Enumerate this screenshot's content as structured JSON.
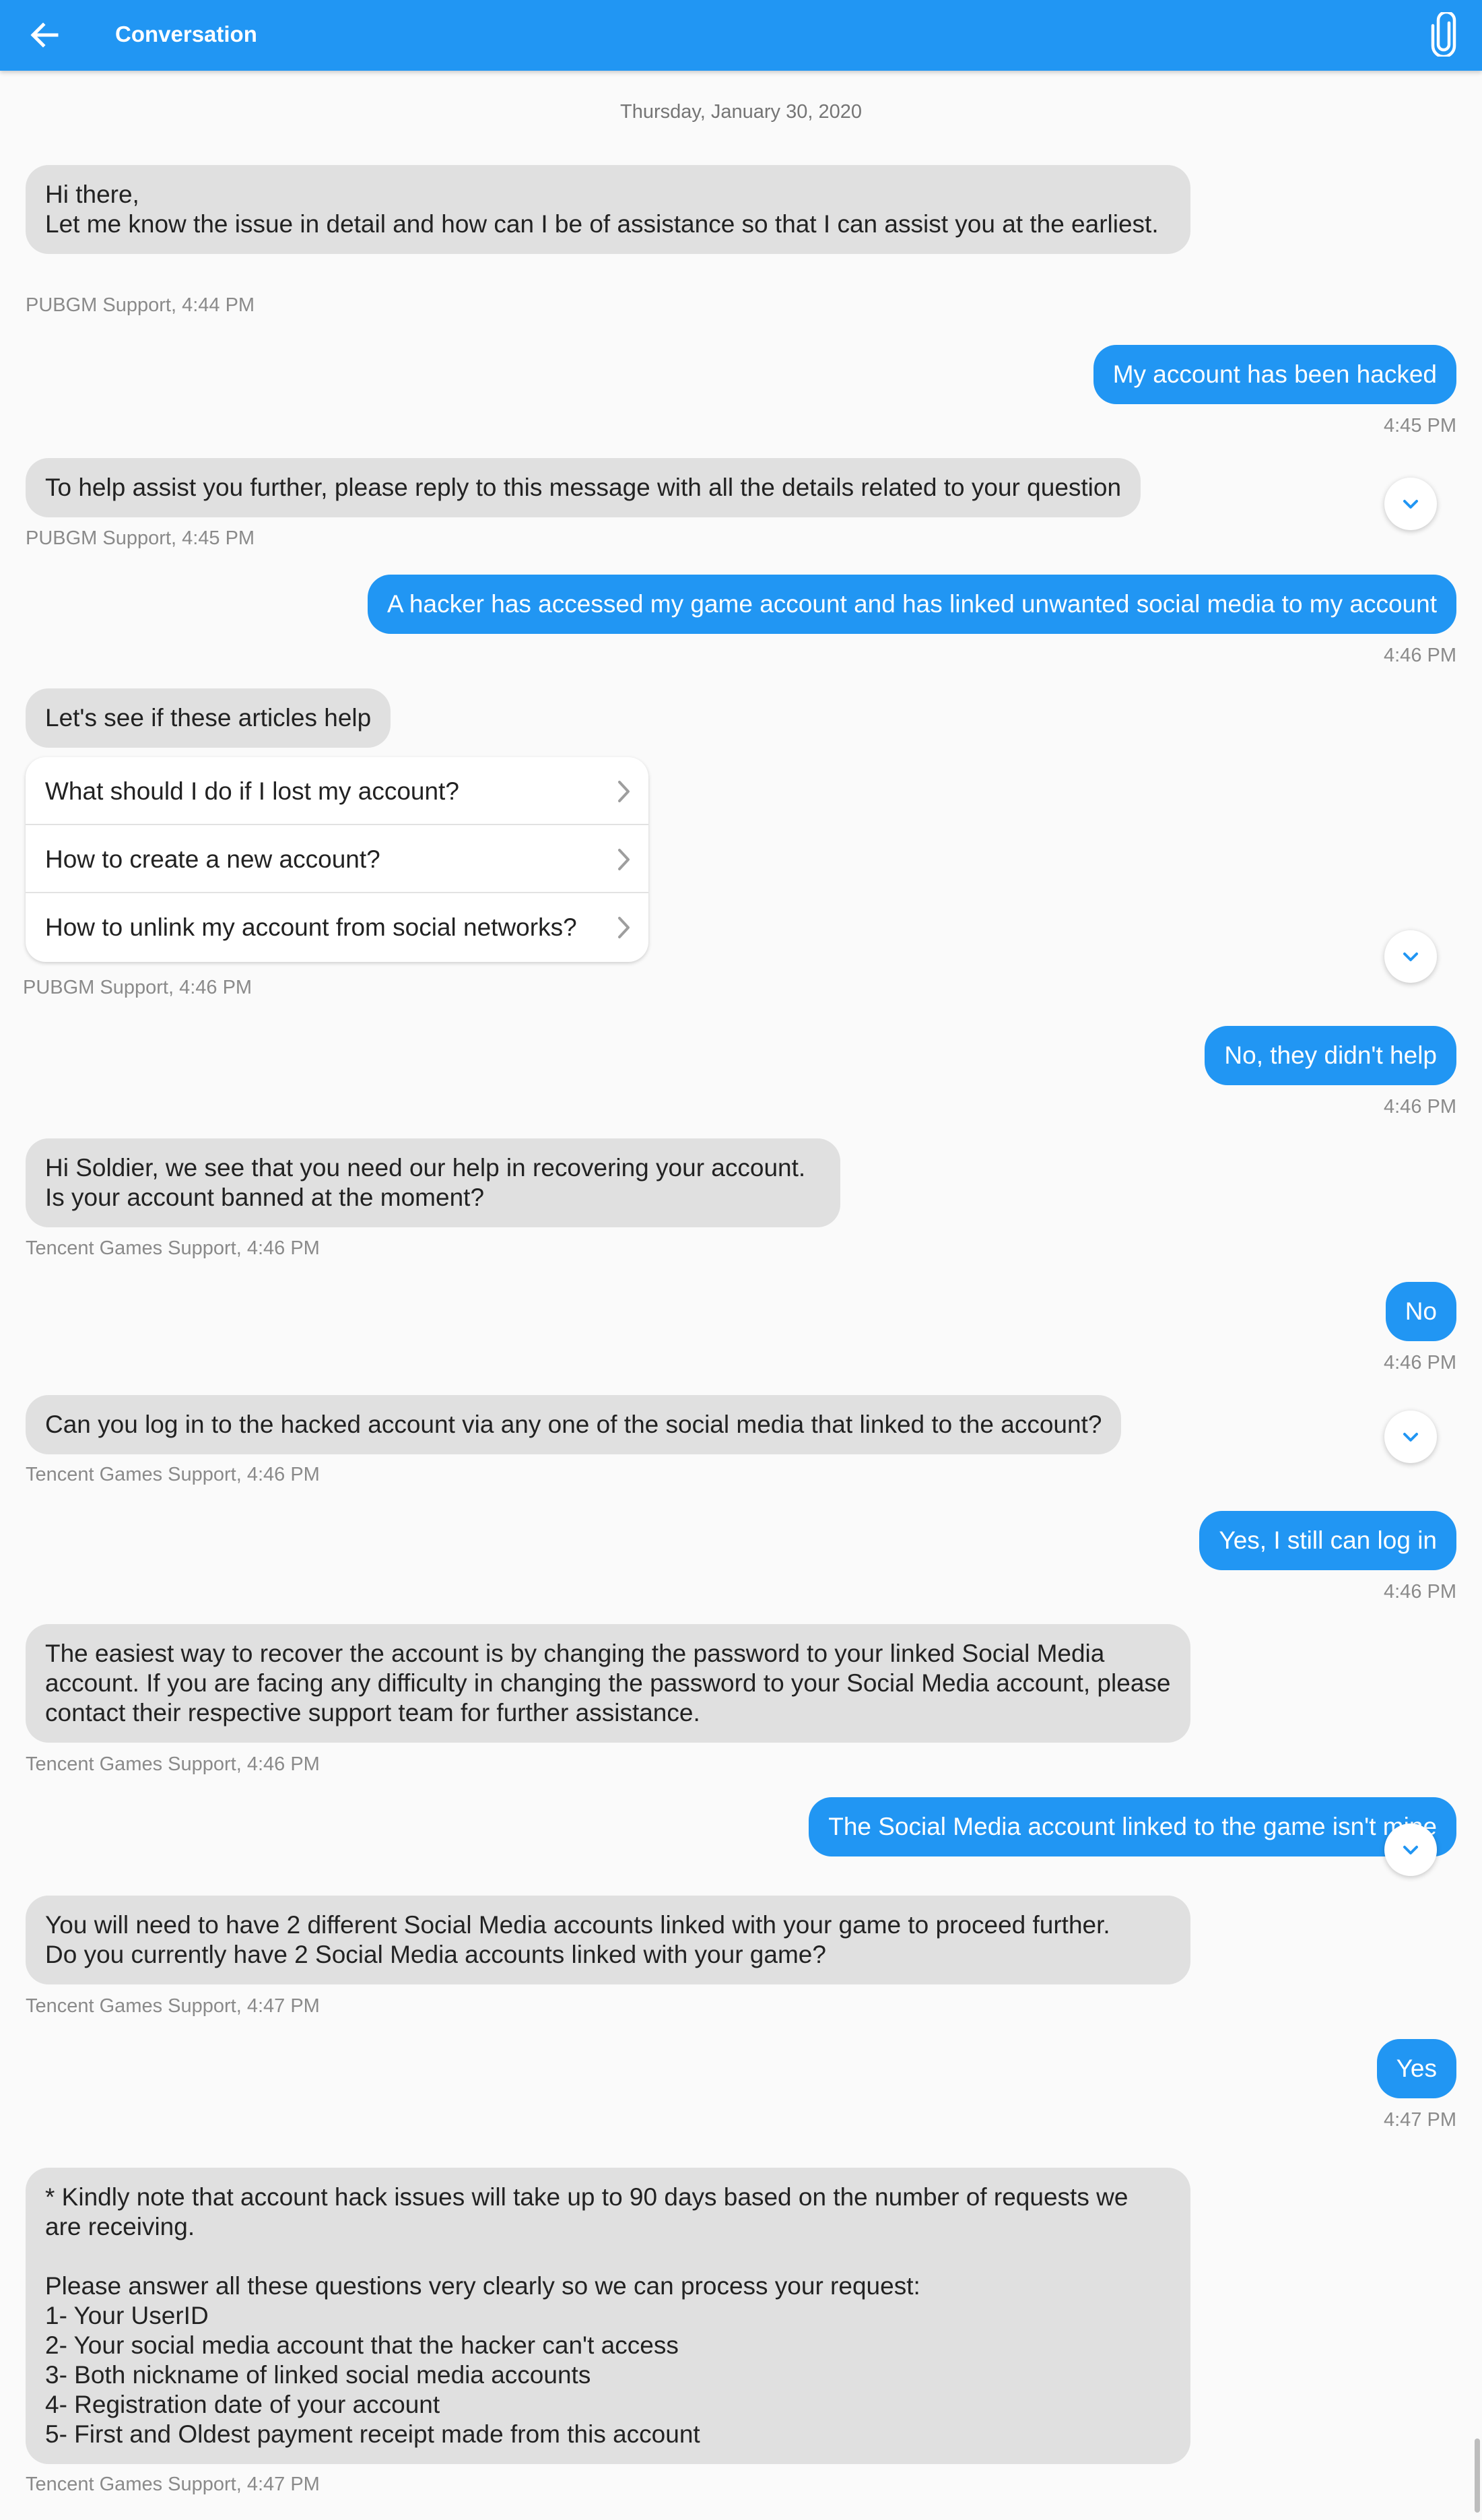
{
  "header": {
    "title": "Conversation",
    "back_icon": "arrow-left-icon",
    "attach_icon": "paperclip-icon"
  },
  "date_separator": "Thursday, January 30, 2020",
  "messages": [
    {
      "text": "Hi there,\nLet me know the issue in detail and how can I be of assistance so that I can assist you at the earliest.",
      "meta": "PUBGM Support, 4:44 PM"
    },
    {
      "text": "My account has been hacked",
      "meta": "4:45 PM"
    },
    {
      "text": "To help assist you further, please reply to this message with all the details related to your question",
      "meta": "PUBGM Support, 4:45 PM"
    },
    {
      "text": "A hacker has accessed my game account and has linked unwanted social media to my account",
      "meta": "4:46 PM"
    },
    {
      "text": "Let's see if these articles help",
      "meta": "PUBGM Support, 4:46 PM"
    },
    {
      "text": "No, they didn't help",
      "meta": "4:46 PM"
    },
    {
      "text": "Hi Soldier, we see that you need our help in recovering your account.\nIs your account banned at the moment?",
      "meta": "Tencent Games Support, 4:46 PM"
    },
    {
      "text": "No",
      "meta": "4:46 PM"
    },
    {
      "text": "Can you log in to the hacked account via any one of the social media that linked to the account?",
      "meta": "Tencent Games Support, 4:46 PM"
    },
    {
      "text": "Yes, I still can log in",
      "meta": "4:46 PM"
    },
    {
      "text": "The easiest way to recover the account is by changing the password to your linked Social Media account. If you are facing any difficulty in changing the password to your Social Media account, please contact their respective support team for further assistance.",
      "meta": "Tencent Games Support, 4:46 PM"
    },
    {
      "text": "The Social Media account linked to the game isn't mine",
      "meta": ""
    },
    {
      "text": "You will need to have 2 different Social Media accounts linked with your game to proceed further.\nDo you currently have 2 Social Media accounts linked with your game?",
      "meta": "Tencent Games Support, 4:47 PM"
    },
    {
      "text": "Yes",
      "meta": "4:47 PM"
    },
    {
      "text": "* Kindly note that account hack issues will take up to 90 days based on the number of requests we are receiving.\n\nPlease answer all these questions very clearly so we can process your request:\n1- Your UserID\n2- Your social media account that the hacker can't access\n3- Both nickname of linked social media accounts\n4- Registration date of your account\n5- First and Oldest payment receipt made from this account",
      "meta": "Tencent Games Support, 4:47 PM"
    }
  ],
  "faq_articles": [
    "What should I do if I lost my account?",
    "How to create a new account?",
    "How to unlink my account from social networks?"
  ],
  "icons": {
    "faq_chevron": "chevron-right-icon",
    "scroll_button": "chevron-down-icon"
  },
  "colors": {
    "accent": "#2196f3",
    "incoming_bubble": "#e0e0e0",
    "background": "#fafafa"
  }
}
